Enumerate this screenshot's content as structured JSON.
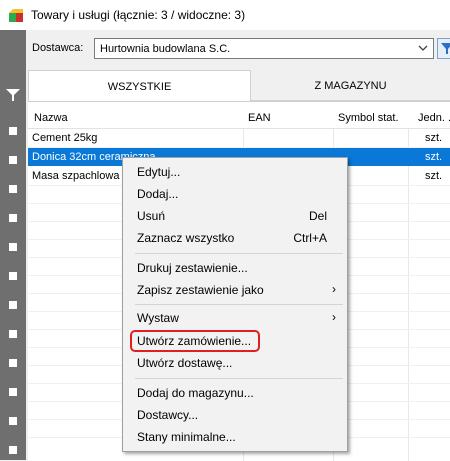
{
  "window": {
    "title": "Towary i usługi (łącznie: 3 / widoczne: 3)",
    "icon": "app-cube-icon"
  },
  "supplier": {
    "label": "Dostawca:",
    "value": "Hurtownia budowlana S.C."
  },
  "tabs": [
    {
      "label": "WSZYSTKIE",
      "active": true
    },
    {
      "label": "Z MAGAZYNU",
      "active": false
    }
  ],
  "grid": {
    "columns": [
      "Nazwa",
      "EAN",
      "Symbol stat.",
      "Jedn. ..."
    ],
    "rows": [
      {
        "name": "Cement 25kg",
        "unit": "szt.",
        "selected": false
      },
      {
        "name": "Donica 32cm ceramiczna",
        "unit": "szt.",
        "selected": true
      },
      {
        "name": "Masa szpachlowa",
        "unit": "szt.",
        "selected": false
      }
    ]
  },
  "context_menu": {
    "items": [
      {
        "label": "Edytuj...",
        "shortcut": ""
      },
      {
        "label": "Dodaj...",
        "shortcut": ""
      },
      {
        "label": "Usuń",
        "shortcut": "Del"
      },
      {
        "label": "Zaznacz wszystko",
        "shortcut": "Ctrl+A"
      },
      {
        "label": "Drukuj zestawienie...",
        "shortcut": ""
      },
      {
        "label": "Zapisz zestawienie jako",
        "submenu": true
      },
      {
        "label": "Wystaw",
        "submenu": true
      },
      {
        "label": "Utwórz zamówienie...",
        "highlighted": true
      },
      {
        "label": "Utwórz dostawę...",
        "shortcut": ""
      },
      {
        "label": "Dodaj do magazynu...",
        "shortcut": ""
      },
      {
        "label": "Dostawcy...",
        "shortcut": ""
      },
      {
        "label": "Stany minimalne...",
        "shortcut": ""
      }
    ],
    "submenu_glyph": "›"
  },
  "colors": {
    "selection": "#0a78d7",
    "highlight_box": "#e02020",
    "strip": "#6f6f6f"
  }
}
